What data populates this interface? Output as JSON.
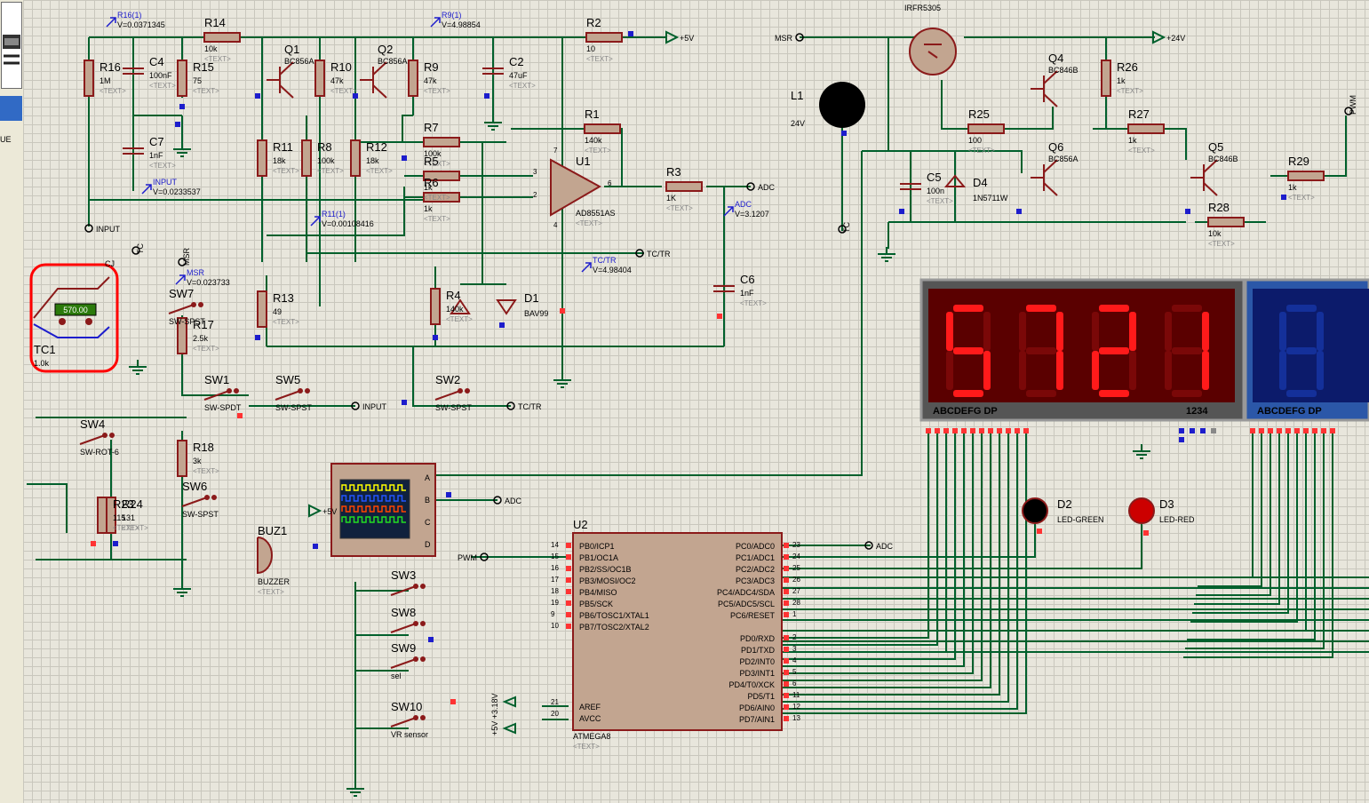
{
  "sidebar": {
    "text": "UE"
  },
  "resistors": [
    {
      "id": "R14",
      "ref": "R14",
      "val": "10k"
    },
    {
      "id": "R16",
      "ref": "R16",
      "val": "1M"
    },
    {
      "id": "R15",
      "ref": "R15",
      "val": "75"
    },
    {
      "id": "R10",
      "ref": "R10",
      "val": "47k"
    },
    {
      "id": "R9",
      "ref": "R9",
      "val": "47k"
    },
    {
      "id": "R2",
      "ref": "R2",
      "val": "10"
    },
    {
      "id": "R11",
      "ref": "R11",
      "val": "18k"
    },
    {
      "id": "R8",
      "ref": "R8",
      "val": "100k"
    },
    {
      "id": "R12",
      "ref": "R12",
      "val": "18k"
    },
    {
      "id": "R7",
      "ref": "R7",
      "val": "100k"
    },
    {
      "id": "R5",
      "ref": "R5",
      "val": "1k"
    },
    {
      "id": "R6",
      "ref": "R6",
      "val": "1k"
    },
    {
      "id": "R1",
      "ref": "R1",
      "val": "140k"
    },
    {
      "id": "R3",
      "ref": "R3",
      "val": "1K"
    },
    {
      "id": "R13",
      "ref": "R13",
      "val": "49"
    },
    {
      "id": "R4",
      "ref": "R4",
      "val": "140k"
    },
    {
      "id": "R17",
      "ref": "R17",
      "val": "2.5k"
    },
    {
      "id": "R18",
      "ref": "R18",
      "val": "3k"
    },
    {
      "id": "R23",
      "ref": "R23",
      "val": "115"
    },
    {
      "id": "R24",
      "ref": "R24",
      "val": "131"
    },
    {
      "id": "R25",
      "ref": "R25",
      "val": "100"
    },
    {
      "id": "R26",
      "ref": "R26",
      "val": "1k"
    },
    {
      "id": "R27",
      "ref": "R27",
      "val": "1k"
    },
    {
      "id": "R28",
      "ref": "R28",
      "val": "10k"
    },
    {
      "id": "R29",
      "ref": "R29",
      "val": "1k"
    }
  ],
  "capacitors": [
    {
      "id": "C4",
      "ref": "C4",
      "val": "100nF"
    },
    {
      "id": "C7",
      "ref": "C7",
      "val": "1nF"
    },
    {
      "id": "C2",
      "ref": "C2",
      "val": "47uF"
    },
    {
      "id": "C6",
      "ref": "C6",
      "val": "1nF"
    },
    {
      "id": "C5",
      "ref": "C5",
      "val": "100n"
    }
  ],
  "transistors": [
    {
      "id": "Q1",
      "ref": "Q1",
      "val": "BC856A"
    },
    {
      "id": "Q2",
      "ref": "Q2",
      "val": "BC856A"
    },
    {
      "id": "Q4",
      "ref": "Q4",
      "val": "BC846B"
    },
    {
      "id": "Q6",
      "ref": "Q6",
      "val": "BC856A"
    },
    {
      "id": "Q5",
      "ref": "Q5",
      "val": "BC846B"
    }
  ],
  "probes": [
    {
      "id": "R16p",
      "label": "R16(1)",
      "val": "V=0.0371345"
    },
    {
      "id": "R9p",
      "label": "R9(1)",
      "val": "V=4.98854"
    },
    {
      "id": "INPUTp",
      "label": "INPUT",
      "val": "V=0.0233537"
    },
    {
      "id": "R11p",
      "label": "R11(1)",
      "val": "V=0.00108416"
    },
    {
      "id": "ADCp",
      "label": "ADC",
      "val": "V=3.1207"
    },
    {
      "id": "TCTRp",
      "label": "TC/TR",
      "val": "V=4.98404"
    },
    {
      "id": "MSRp",
      "label": "MSR",
      "val": "V=0.023733"
    }
  ],
  "labels": {
    "text_placeholder": "<TEXT>",
    "plus5v": "+5V",
    "plus24v": "+24V",
    "msr": "MSR",
    "adc": "ADC",
    "tctr": "TC/TR",
    "input": "INPUT",
    "tc": "TC",
    "pwm": "PWM",
    "cj": "CJ",
    "plus5v_318v": "+5V +3.18V"
  },
  "opamp": {
    "ref": "U1",
    "val": "AD8551AS",
    "pin3": "3",
    "pin2": "2",
    "pin6": "6",
    "pin7": "7",
    "pin4": "4"
  },
  "diodes": {
    "d1_ref": "D1",
    "d1_val": "BAV99",
    "d4_ref": "D4",
    "d4_val": "1N5711W"
  },
  "mosfet": {
    "val": "IRFR5305"
  },
  "coil": {
    "ref": "L1",
    "val": "24V"
  },
  "thermocouple": {
    "ref": "TC1",
    "val": "1.0k",
    "reading": "570.00"
  },
  "switches": [
    {
      "id": "SW7",
      "ref": "SW7",
      "val": "SW-SPST"
    },
    {
      "id": "SW1",
      "ref": "SW1",
      "val": "SW-SPDT"
    },
    {
      "id": "SW5",
      "ref": "SW5",
      "val": "SW-SPST"
    },
    {
      "id": "SW2",
      "ref": "SW2",
      "val": "SW-SPST"
    },
    {
      "id": "SW4",
      "ref": "SW4",
      "val": "SW-ROT-6"
    },
    {
      "id": "SW6",
      "ref": "SW6",
      "val": "SW-SPST"
    },
    {
      "id": "SW3",
      "ref": "SW3",
      "val": ""
    },
    {
      "id": "SW8",
      "ref": "SW8",
      "val": ""
    },
    {
      "id": "SW9",
      "ref": "SW9",
      "val": "sel"
    },
    {
      "id": "SW10",
      "ref": "SW10",
      "val": "VR sensor"
    }
  ],
  "buzzer": {
    "ref": "BUZ1",
    "val": "BUZZER"
  },
  "scope": {
    "A": "A",
    "B": "B",
    "C": "C",
    "D": "D"
  },
  "mcu": {
    "ref": "U2",
    "val": "ATMEGA8",
    "left_pins": [
      {
        "name": "PB0/ICP1",
        "num": "14"
      },
      {
        "name": "PB1/OC1A",
        "num": "15"
      },
      {
        "name": "PB2/SS/OC1B",
        "num": "16"
      },
      {
        "name": "PB3/MOSI/OC2",
        "num": "17"
      },
      {
        "name": "PB4/MISO",
        "num": "18"
      },
      {
        "name": "PB5/SCK",
        "num": "19"
      },
      {
        "name": "PB6/TOSC1/XTAL1",
        "num": "9"
      },
      {
        "name": "PB7/TOSC2/XTAL2",
        "num": "10"
      }
    ],
    "right_pins": [
      {
        "name": "PC0/ADC0",
        "num": "23"
      },
      {
        "name": "PC1/ADC1",
        "num": "24"
      },
      {
        "name": "PC2/ADC2",
        "num": "25"
      },
      {
        "name": "PC3/ADC3",
        "num": "26"
      },
      {
        "name": "PC4/ADC4/SDA",
        "num": "27"
      },
      {
        "name": "PC5/ADC5/SCL",
        "num": "28"
      },
      {
        "name": "PC6/RESET",
        "num": "1"
      },
      {
        "name": "PD0/RXD",
        "num": "2"
      },
      {
        "name": "PD1/TXD",
        "num": "3"
      },
      {
        "name": "PD2/INT0",
        "num": "4"
      },
      {
        "name": "PD3/INT1",
        "num": "5"
      },
      {
        "name": "PD4/T0/XCK",
        "num": "6"
      },
      {
        "name": "PD5/T1",
        "num": "11"
      },
      {
        "name": "PD6/AIN0",
        "num": "12"
      },
      {
        "name": "PD7/AIN1",
        "num": "13"
      }
    ],
    "aref": "AREF",
    "aref_num": "21",
    "avcc": "AVCC",
    "avcc_num": "20"
  },
  "display": {
    "digits": "5721",
    "segments_label": "ABCDEFG DP",
    "digits_label": "1234",
    "color": "#ff1a1a"
  },
  "display2": {
    "segments_label": "ABCDEFG DP"
  },
  "leds": {
    "d2_ref": "D2",
    "d2_val": "LED-GREEN",
    "d3_ref": "D3",
    "d3_val": "LED-RED"
  },
  "colors": {
    "wire": "#00602c",
    "part": "#8b1a1a",
    "probe": "#1d1dcc",
    "grid": "#c9c7bd"
  }
}
